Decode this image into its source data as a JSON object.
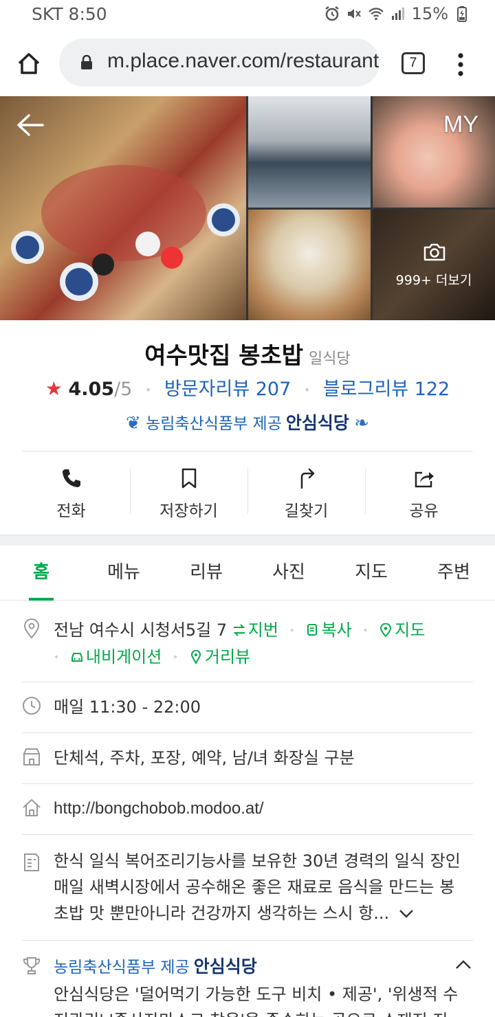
{
  "status_bar": {
    "carrier_time": "SKT 8:50",
    "battery": "15%"
  },
  "browser": {
    "url": "m.place.naver.com/restaurant",
    "tab_count": "7"
  },
  "gallery": {
    "my_label": "MY",
    "more_photos": "999+ 더보기"
  },
  "place": {
    "name": "여수맛집 봉초밥",
    "category": "일식당",
    "rating": "4.05",
    "rating_max": "/5",
    "visitor_reviews": "방문자리뷰 207",
    "blog_reviews": "블로그리뷰 122",
    "safe_provider": "농림축산식품부 제공",
    "safe_brand": "안심식당"
  },
  "actions": [
    {
      "label": "전화",
      "icon": "phone-icon"
    },
    {
      "label": "저장하기",
      "icon": "bookmark-icon"
    },
    {
      "label": "길찾기",
      "icon": "directions-icon"
    },
    {
      "label": "공유",
      "icon": "share-icon"
    }
  ],
  "tabs": [
    {
      "label": "홈",
      "active": true
    },
    {
      "label": "메뉴"
    },
    {
      "label": "리뷰"
    },
    {
      "label": "사진"
    },
    {
      "label": "지도"
    },
    {
      "label": "주변"
    }
  ],
  "info": {
    "address": "전남 여수시 시청서5길 7",
    "address_links": {
      "jibun": "지번",
      "copy": "복사",
      "map": "지도",
      "navigation": "내비게이션",
      "street_view": "거리뷰"
    },
    "hours": "매일 11:30 - 22:00",
    "facilities": "단체석, 주차, 포장, 예약, 남/녀 화장실 구분",
    "homepage": "http://bongchobob.modoo.at/",
    "description_lines": [
      "한식 일식 복어조리기능사를 보유한 30년 경력의 일식 장인",
      "매일 새벽시장에서 공수해온 좋은 재료로 음식을 만드는 봉",
      "초밥 맛 뿐만아니라 건강까지 생각하는 스시 항..."
    ],
    "safe_section": {
      "provider": "농림축산식품부 제공",
      "brand": "안심식당",
      "text_line1": "안심식당은 '덜어먹기 가능한 도구 비치 • 제공', '위생적 수",
      "text_line2": "저관리' '종사자마스크 착용'을 준수하는 곳으로 소재지 지"
    }
  },
  "colors": {
    "naver_green": "#03a94a",
    "link_blue": "#1d63b8",
    "star_red": "#e5353a"
  }
}
